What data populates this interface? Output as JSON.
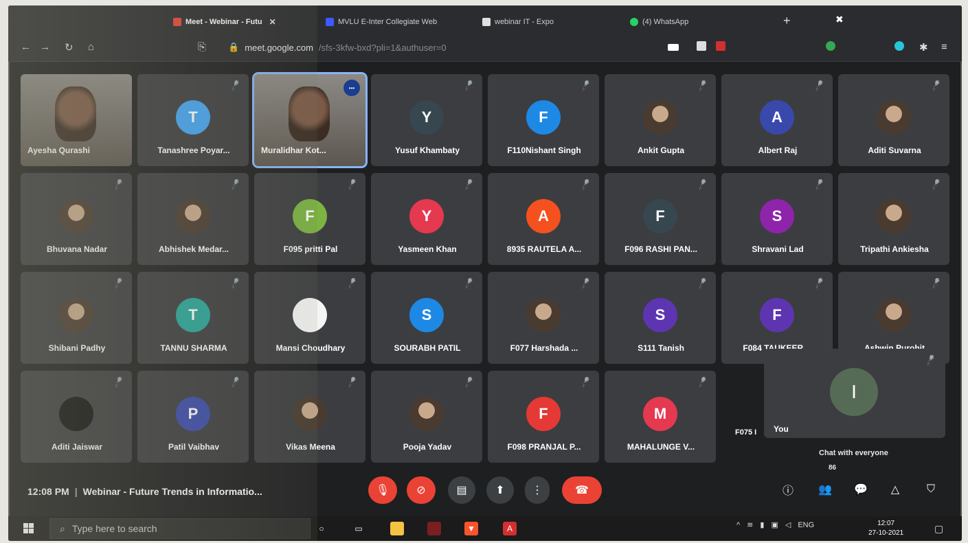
{
  "browser": {
    "tabs": [
      {
        "label": "Meet - Webinar - Futu",
        "active": true,
        "color": "#ea4335"
      },
      {
        "label": "MVLU E-Inter Collegiate Web",
        "active": false,
        "color": "#3d5afe"
      },
      {
        "label": "webinar IT - Expo",
        "active": false,
        "color": "#e0e0e0"
      },
      {
        "label": "(4) WhatsApp",
        "active": false,
        "color": "#25d366"
      }
    ],
    "url_host": "meet.google.com",
    "url_rest": "/sfs-3kfw-bxd?pli=1&authuser=0"
  },
  "participants": [
    {
      "name": "Ayesha Qurashi",
      "initial": "",
      "color": "",
      "type": "video"
    },
    {
      "name": "Tanashree Poyar...",
      "initial": "T",
      "color": "#42a5f5",
      "type": "avatar"
    },
    {
      "name": "Muralidhar Kot...",
      "initial": "",
      "color": "",
      "type": "pinned"
    },
    {
      "name": "Yusuf Khambaty",
      "initial": "Y",
      "color": "#37474f",
      "type": "avatar"
    },
    {
      "name": "F110Nishant Singh",
      "initial": "F",
      "color": "#1e88e5",
      "type": "avatar"
    },
    {
      "name": "Ankit Gupta",
      "initial": "",
      "color": "",
      "type": "photo"
    },
    {
      "name": "Albert Raj",
      "initial": "A",
      "color": "#3949ab",
      "type": "avatar"
    },
    {
      "name": "Aditi Suvarna",
      "initial": "",
      "color": "",
      "type": "photo"
    },
    {
      "name": "Bhuvana Nadar",
      "initial": "",
      "color": "",
      "type": "photo"
    },
    {
      "name": "Abhishek Medar...",
      "initial": "",
      "color": "",
      "type": "photo"
    },
    {
      "name": "F095 pritti Pal",
      "initial": "F",
      "color": "#7cb342",
      "type": "avatar"
    },
    {
      "name": "Yasmeen Khan",
      "initial": "Y",
      "color": "#e53950",
      "type": "avatar"
    },
    {
      "name": "8935 RAUTELA A...",
      "initial": "A",
      "color": "#f4511e",
      "type": "avatar"
    },
    {
      "name": "F096 RASHI PAN...",
      "initial": "F",
      "color": "#37474f",
      "type": "avatar"
    },
    {
      "name": "Shravani Lad",
      "initial": "S",
      "color": "#8e24aa",
      "type": "avatar"
    },
    {
      "name": "Tripathi Ankiesha",
      "initial": "",
      "color": "",
      "type": "photo"
    },
    {
      "name": "Shibani Padhy",
      "initial": "",
      "color": "",
      "type": "photo"
    },
    {
      "name": "TANNU SHARMA",
      "initial": "T",
      "color": "#26a69a",
      "type": "avatar"
    },
    {
      "name": "Mansi Choudhary",
      "initial": "",
      "color": "#f5f5f5",
      "type": "avatar"
    },
    {
      "name": "SOURABH PATIL",
      "initial": "S",
      "color": "#1e88e5",
      "type": "avatar"
    },
    {
      "name": "F077 Harshada ...",
      "initial": "",
      "color": "",
      "type": "photo"
    },
    {
      "name": "S111 Tanish",
      "initial": "S",
      "color": "#5e35b1",
      "type": "avatar"
    },
    {
      "name": "F084 TAUKEER ...",
      "initial": "F",
      "color": "#5e35b1",
      "type": "avatar"
    },
    {
      "name": "Ashwin Purohit",
      "initial": "",
      "color": "",
      "type": "photo"
    },
    {
      "name": "Aditi Jaiswar",
      "initial": "",
      "color": "#111111",
      "type": "avatar"
    },
    {
      "name": "Patil Vaibhav",
      "initial": "P",
      "color": "#3949ab",
      "type": "avatar"
    },
    {
      "name": "Vikas Meena",
      "initial": "",
      "color": "",
      "type": "photo"
    },
    {
      "name": "Pooja Yadav",
      "initial": "",
      "color": "",
      "type": "photo"
    },
    {
      "name": "F098 PRANJAL P...",
      "initial": "F",
      "color": "#e53935",
      "type": "avatar"
    },
    {
      "name": "MAHALUNGE V...",
      "initial": "M",
      "color": "#e53950",
      "type": "avatar"
    }
  ],
  "self": {
    "name": "You",
    "initial": "I"
  },
  "partial_tile_name": "F075 I",
  "meeting": {
    "time": "12:08 PM",
    "separator": "|",
    "title": "Webinar - Future Trends in Informatio...",
    "chat_label": "Chat with everyone",
    "people_count": "86"
  },
  "taskbar": {
    "search_placeholder": "Type here to search",
    "lang": "ENG",
    "time": "12:07",
    "date": "27-10-2021"
  },
  "colors": {
    "meet_bg": "#1e1f21",
    "tile_bg": "#3c3d40",
    "end_call_red": "#ea4335",
    "pinned_outline": "#8ab4f8"
  }
}
